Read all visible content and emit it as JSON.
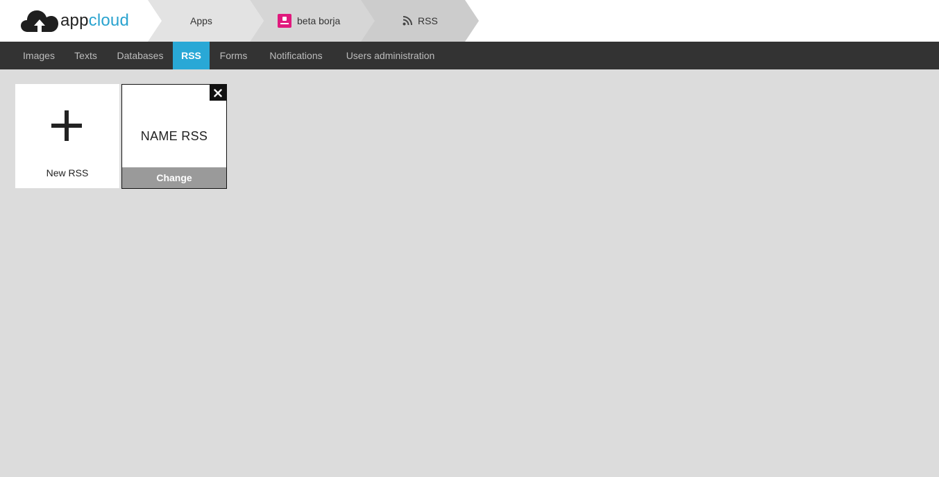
{
  "header": {
    "logo": {
      "part1": "app",
      "part2": "cloud"
    },
    "breadcrumbs": [
      {
        "label": "Apps"
      },
      {
        "label": "beta borja",
        "icon": "app-icon"
      },
      {
        "label": "RSS",
        "icon": "rss-icon"
      }
    ]
  },
  "nav": {
    "items": [
      {
        "label": "Images"
      },
      {
        "label": "Texts"
      },
      {
        "label": "Databases"
      },
      {
        "label": "RSS",
        "active": true
      },
      {
        "label": "Forms"
      },
      {
        "label": "Notifications"
      },
      {
        "label": "Users administration"
      }
    ]
  },
  "tiles": {
    "new_label": "New RSS",
    "feed": {
      "name": "NAME RSS",
      "change_label": "Change"
    }
  },
  "colors": {
    "accent": "#29a8d6",
    "nav_bg": "#333333",
    "page_bg": "#dcdcdc",
    "app_badge": "#e0197d"
  }
}
